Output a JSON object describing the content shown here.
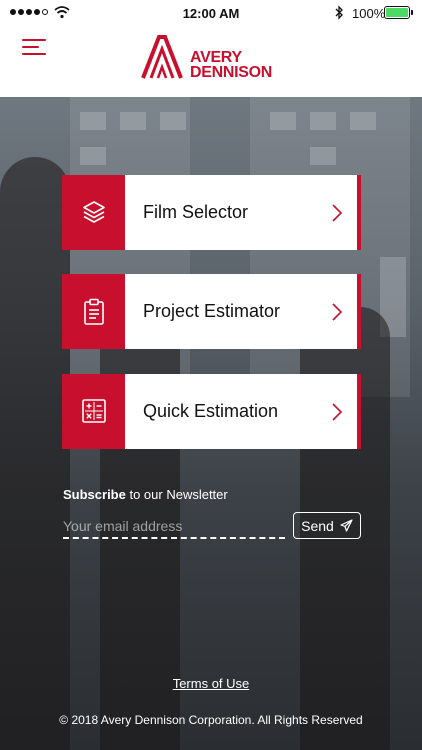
{
  "status_bar": {
    "time": "12:00 AM",
    "battery_percent": "100%",
    "battery_level": 1.0,
    "icons": [
      "signal-dots-icon",
      "wifi-icon",
      "bluetooth-icon",
      "battery-icon"
    ]
  },
  "header": {
    "menu_icon": "hamburger-menu-icon",
    "logo_line1": "AVERY",
    "logo_line2": "DENNISON"
  },
  "menu": {
    "items": [
      {
        "label": "Film Selector",
        "icon": "layers-icon"
      },
      {
        "label": "Project Estimator",
        "icon": "clipboard-icon"
      },
      {
        "label": "Quick Estimation",
        "icon": "calculator-icon"
      }
    ]
  },
  "newsletter": {
    "title_bold": "Subscribe",
    "title_rest": " to our Newsletter",
    "email_placeholder": "Your email address",
    "email_value": "",
    "send_label": "Send",
    "send_icon": "paper-plane-icon"
  },
  "footer": {
    "terms_label": "Terms of Use",
    "copyright": "© 2018 Avery Dennison Corporation. All Rights Reserved"
  },
  "colors": {
    "brand_red": "#c8102e",
    "battery_green": "#4cd964"
  }
}
